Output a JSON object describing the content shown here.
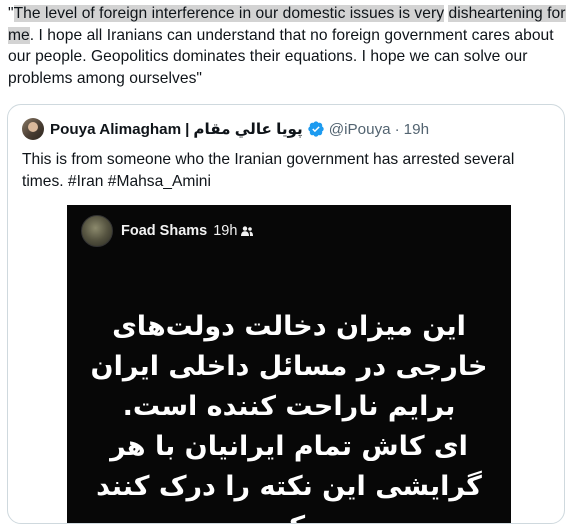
{
  "main_tweet": {
    "open_quote": "\"",
    "highlighted_1": "The level of foreign interference in our domestic issues is very",
    "highlighted_2": "disheartening for me",
    "rest": ". I hope all Iranians can understand that no foreign government cares about our people. Geopolitics dominates their equations. I hope we can solve our problems among ourselves\""
  },
  "quoted_tweet": {
    "author_name": "Pouya Alimagham",
    "author_name_separator": "|",
    "author_name_arabic": "پویا عالي مقام",
    "verified_icon": "verified-badge-icon",
    "handle": "@iPouya",
    "separator": "·",
    "time": "19h",
    "text": "This is from someone who the Iranian government has arrested several times. #Iran #Mahsa_Amini",
    "media": {
      "story_author": "Foad Shams",
      "story_time": "19h",
      "audience_icon": "friends-icon",
      "persian_lines": [
        "این میزان دخالت دولت‌های",
        "خارجی در مسائل داخلی ایران",
        "برایم ناراحت کننده است.",
        "ای کاش تمام ایرانیان با هر",
        "گرایشی این نکته را درک کنند که"
      ]
    }
  },
  "colors": {
    "highlight": "#d3d3d3",
    "verified_blue": "#1d9bf0",
    "secondary_text": "#536471",
    "card_border": "#cfd9de",
    "media_bg": "#070707"
  }
}
